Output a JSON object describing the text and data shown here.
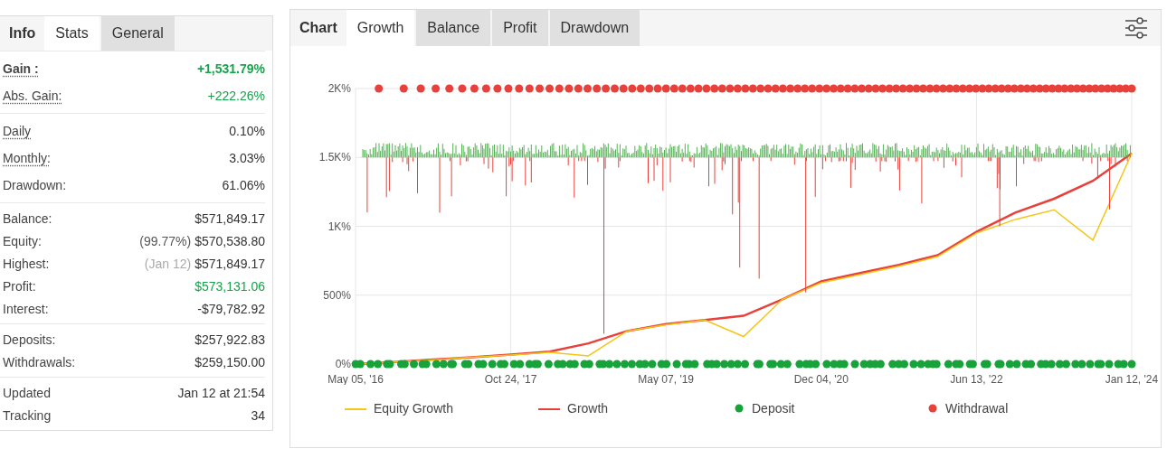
{
  "info_panel": {
    "title": "Info",
    "tabs": [
      {
        "label": "Stats",
        "selected": true
      },
      {
        "label": "General",
        "selected": false
      }
    ],
    "sections": [
      [
        {
          "label": "Gain :",
          "value": "+1,531.79%",
          "bold": true,
          "dotted": true,
          "positive": true
        },
        {
          "label": "Abs. Gain:",
          "value": "+222.26%",
          "bold": false,
          "dotted": true,
          "positive": true
        }
      ],
      [
        {
          "label": "Daily",
          "value": "0.10%",
          "bold": false,
          "dotted": true,
          "positive": false
        },
        {
          "label": "Monthly:",
          "value": "3.03%",
          "bold": false,
          "dotted": true,
          "positive": false
        },
        {
          "label": "Drawdown:",
          "value": "61.06%",
          "bold": false,
          "dotted": false,
          "positive": false
        }
      ],
      [
        {
          "label": "Balance:",
          "value": "$571,849.17",
          "bold": false,
          "dotted": false,
          "positive": false
        },
        {
          "label": "Equity:",
          "note": "(99.77%)",
          "note_muted": false,
          "value": "$570,538.80",
          "bold": false,
          "dotted": false,
          "positive": false
        },
        {
          "label": "Highest:",
          "note": "(Jan 12)",
          "note_muted": true,
          "value": "$571,849.17",
          "bold": false,
          "dotted": false,
          "positive": false
        },
        {
          "label": "Profit:",
          "value": "$573,131.06",
          "bold": false,
          "dotted": false,
          "positive": true
        },
        {
          "label": "Interest:",
          "value": "-$79,782.92",
          "bold": false,
          "dotted": false,
          "positive": false
        }
      ],
      [
        {
          "label": "Deposits:",
          "value": "$257,922.83",
          "bold": false,
          "dotted": false,
          "positive": false
        },
        {
          "label": "Withdrawals:",
          "value": "$259,150.00",
          "bold": false,
          "dotted": false,
          "positive": false
        }
      ],
      [
        {
          "label": "Updated",
          "value": "Jan 12 at 21:54",
          "bold": false,
          "dotted": false,
          "positive": false
        },
        {
          "label": "Tracking",
          "value": "34",
          "bold": false,
          "dotted": false,
          "positive": false
        }
      ]
    ]
  },
  "chart_panel": {
    "title": "Chart",
    "tabs": [
      {
        "label": "Growth",
        "selected": true
      },
      {
        "label": "Balance",
        "selected": false
      },
      {
        "label": "Profit",
        "selected": false
      },
      {
        "label": "Drawdown",
        "selected": false
      }
    ],
    "chart_data": {
      "type": "line",
      "grid": true,
      "categories": [
        "May 05, '16",
        null,
        null,
        null,
        "Oct 24, '17",
        null,
        null,
        null,
        "May 07, '19",
        null,
        null,
        null,
        "Dec 04, '20",
        null,
        null,
        null,
        "Jun 13, '22",
        null,
        null,
        null,
        "Jan 12, '24"
      ],
      "yticks": [
        {
          "value": 0,
          "label": "0%"
        },
        {
          "value": 500,
          "label": "500%"
        },
        {
          "value": 1000,
          "label": "1K%"
        },
        {
          "value": 1500,
          "label": "1.5K%"
        },
        {
          "value": 2000,
          "label": "2K%"
        }
      ],
      "ylim": [
        0,
        2000
      ],
      "series": [
        {
          "name": "Equity Growth",
          "color": "#f5c518",
          "values": [
            0,
            15,
            30,
            50,
            65,
            85,
            60,
            240,
            285,
            320,
            200,
            470,
            590,
            650,
            710,
            780,
            950,
            1050,
            1120,
            900,
            1530
          ]
        },
        {
          "name": "Growth",
          "color": "#e8403a",
          "values": [
            0,
            15,
            32,
            50,
            68,
            90,
            150,
            240,
            290,
            320,
            350,
            470,
            600,
            660,
            720,
            790,
            960,
            1100,
            1200,
            1330,
            1530
          ]
        }
      ]
    },
    "markers": [
      {
        "label": "Deposit",
        "color": "#17a33a"
      },
      {
        "label": "Withdrawal",
        "color": "#e8403a"
      }
    ]
  }
}
